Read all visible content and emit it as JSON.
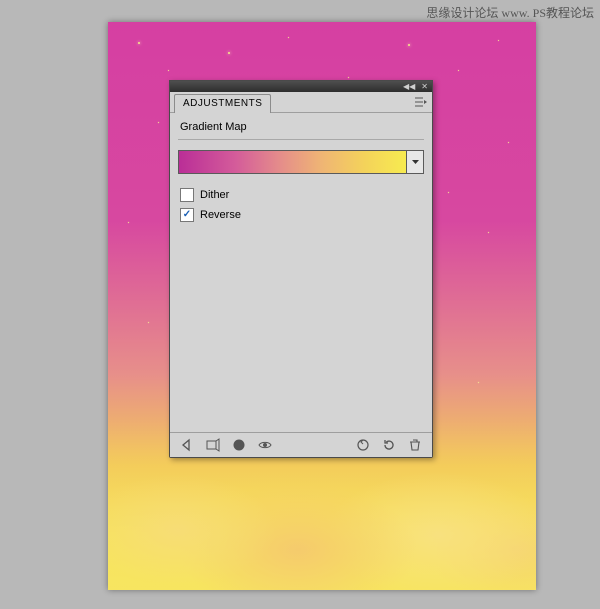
{
  "watermark": "思缘设计论坛 www.  PS教程论坛",
  "panel": {
    "tab_label": "ADJUSTMENTS",
    "title": "Gradient Map",
    "dither_label": "Dither",
    "reverse_label": "Reverse",
    "dither_checked": false,
    "reverse_checked": true,
    "gradient_stops": [
      "#ba2e97",
      "#d45c9a",
      "#e58e8a",
      "#efb574",
      "#f4d35a",
      "#f7eb50"
    ]
  },
  "footer_icons": [
    "back",
    "expand",
    "mask",
    "eye",
    "previous",
    "reset",
    "trash"
  ],
  "colors": {
    "panel_bg": "#d4d4d4",
    "titlebar": "#3a3a3a",
    "stage": "#b8b8b8"
  }
}
